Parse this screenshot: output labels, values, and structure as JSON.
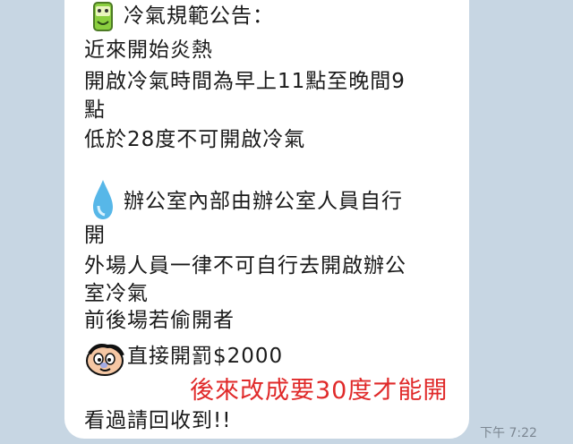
{
  "message": {
    "lines": [
      "冷氣規範公告：",
      "近來開始炎熱",
      "開啟冷氣時間為早上11點至晚間9",
      "點",
      "低於28度不可開啟冷氣",
      "辦公室內部由辦公室人員自行",
      "開",
      "外場人員一律不可自行去開啟辦公",
      "室冷氣",
      "前後場若偷開者",
      "直接開罰$2000",
      "看過請回收到!!"
    ],
    "time": "下午 7:22"
  },
  "annotation": {
    "text": "後來改成要30度才能開",
    "color": "#e02a2a"
  },
  "icons": {
    "first": "green-can-sticker-icon",
    "second": "water-drop-icon",
    "third": "cartoon-face-icon"
  }
}
